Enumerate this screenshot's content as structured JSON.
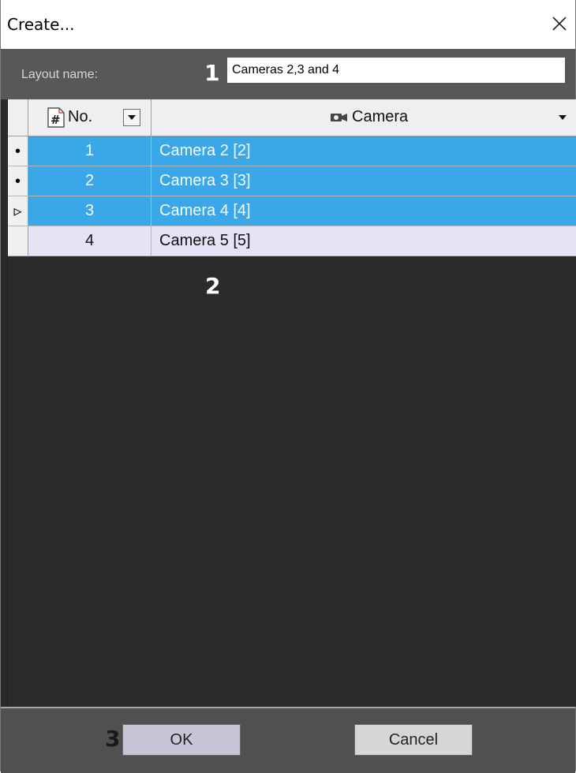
{
  "window": {
    "title": "Create..."
  },
  "layout": {
    "label": "Layout name:",
    "value": "Cameras 2,3 and 4"
  },
  "annotations": {
    "a1": "1",
    "a2": "2",
    "a3": "3"
  },
  "columns": {
    "number": "No.",
    "camera": "Camera"
  },
  "rows": [
    {
      "indicator": "•",
      "number": "1",
      "camera": "Camera 2 [2]",
      "selected": true
    },
    {
      "indicator": "•",
      "number": "2",
      "camera": "Camera 3 [3]",
      "selected": true
    },
    {
      "indicator": "▹",
      "number": "3",
      "camera": "Camera 4 [4]",
      "selected": true
    },
    {
      "indicator": "",
      "number": "4",
      "camera": "Camera 5 [5]",
      "selected": false
    }
  ],
  "buttons": {
    "ok": "OK",
    "cancel": "Cancel"
  },
  "icons": {
    "close": "close-icon",
    "number_column": "hash-icon",
    "camera_column": "camera-icon",
    "dropdown": "chevron-down-icon"
  },
  "colors": {
    "selected_row": "#3aa7e8",
    "unselected_row": "#e5e4f4",
    "background": "#2b2b2b",
    "footer": "#505050"
  }
}
